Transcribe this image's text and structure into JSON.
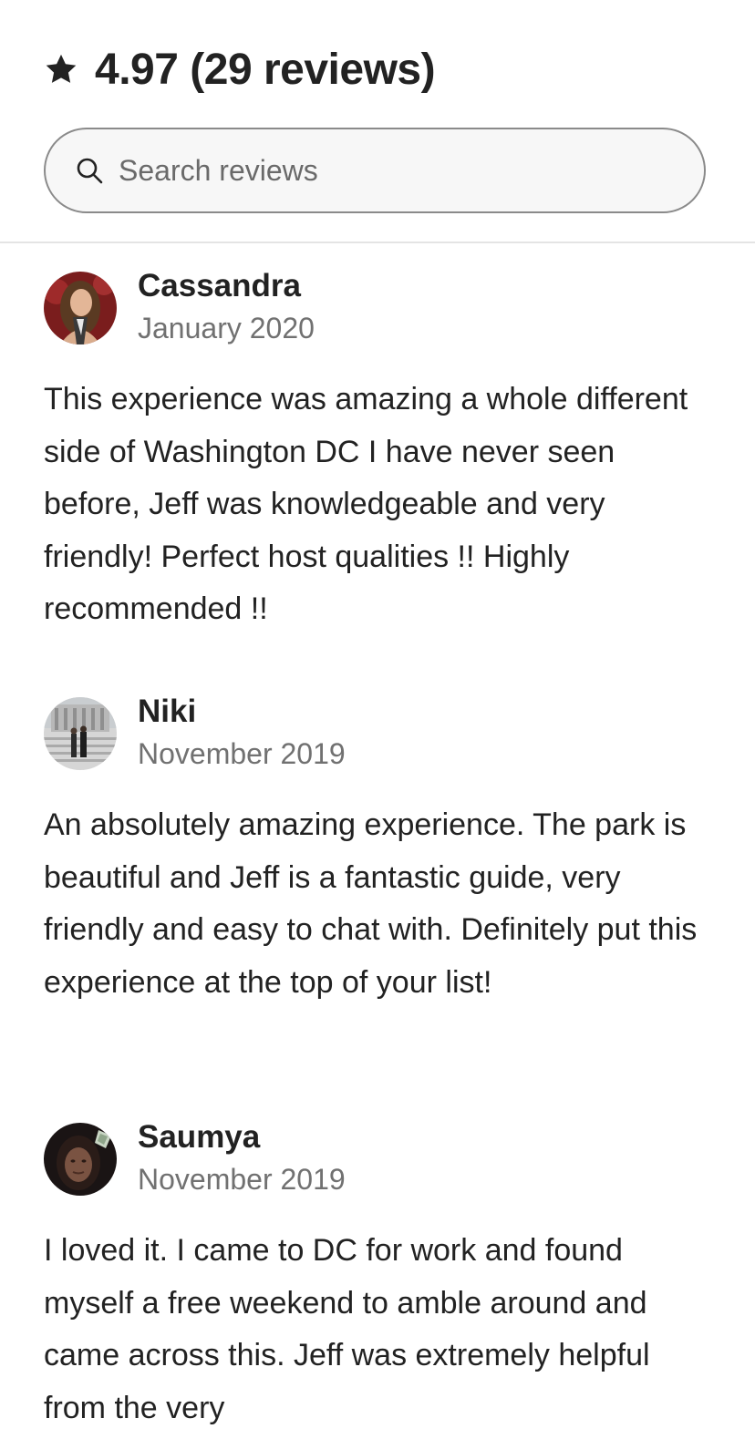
{
  "header": {
    "rating_label": "4.97 (29 reviews)",
    "star_icon": "star-icon"
  },
  "search": {
    "placeholder": "Search reviews",
    "value": "",
    "icon": "search-icon"
  },
  "colors": {
    "text": "#222222",
    "secondary_text": "#717171",
    "border": "#8a8a8a",
    "divider": "#e4e4e4"
  },
  "reviews": [
    {
      "name": "Cassandra",
      "date": "January 2020",
      "text": "This experience was amazing a whole different side of Washington DC I have never seen before, Jeff was knowledgeable and very friendly! Perfect host qualities !! Highly recommended !!"
    },
    {
      "name": "Niki",
      "date": "November 2019",
      "text": "An absolutely amazing experience. The park is beautiful and Jeff is a fantastic guide, very friendly and easy to chat with. Definitely put this experience at the top of your list!"
    },
    {
      "name": "Saumya",
      "date": "November 2019",
      "text": "I loved it. I came to DC for work and found myself a free weekend to amble around and came across this. Jeff was extremely helpful from the very"
    }
  ]
}
